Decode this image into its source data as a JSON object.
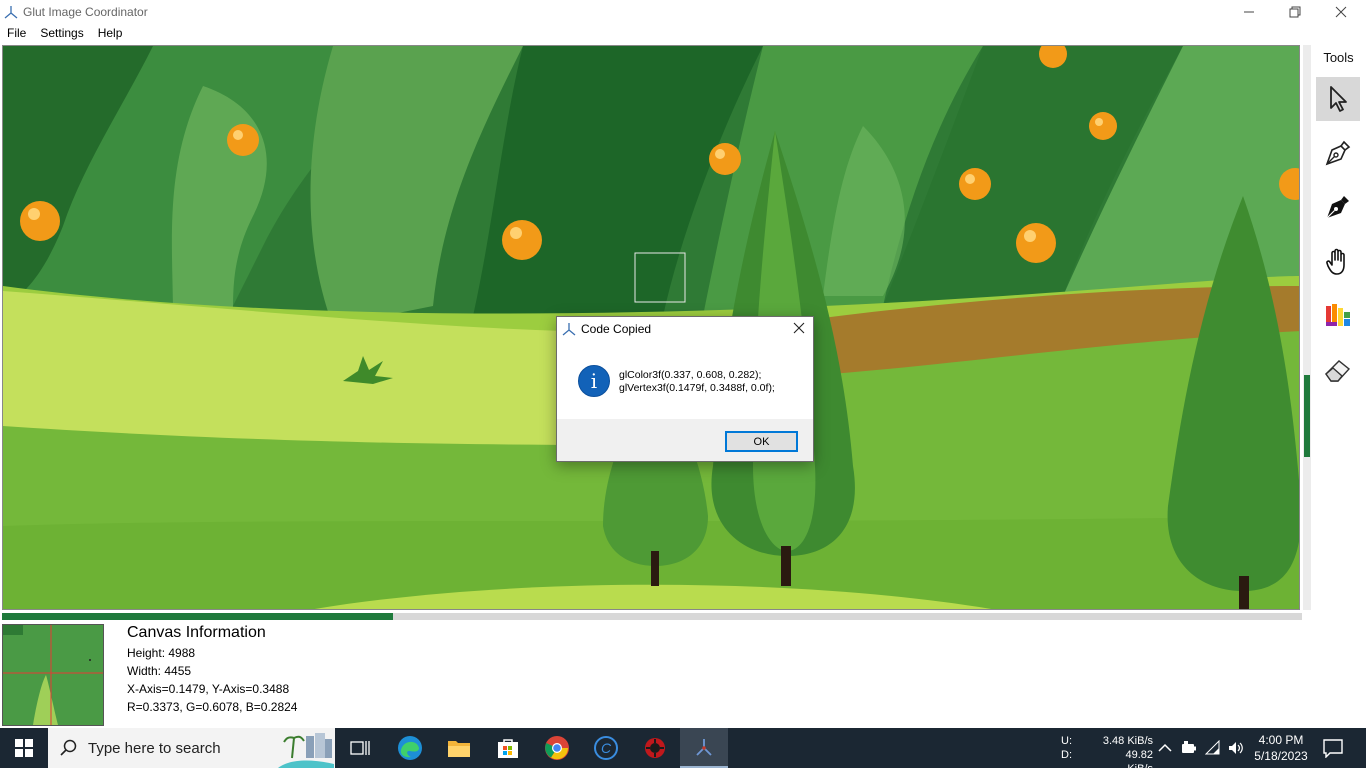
{
  "window": {
    "title": "Glut Image Coordinator"
  },
  "menu": [
    "File",
    "Settings",
    "Help"
  ],
  "tools": {
    "title": "Tools",
    "items": [
      {
        "name": "Select",
        "icon": "cursor-arrow-icon",
        "selected": true
      },
      {
        "name": "Pen outline",
        "icon": "pen-nib-outline-icon",
        "selected": false
      },
      {
        "name": "Pen filled",
        "icon": "pen-nib-filled-icon",
        "selected": false
      },
      {
        "name": "Hand",
        "icon": "hand-icon",
        "selected": false
      },
      {
        "name": "Color palette",
        "icon": "palette-icon",
        "selected": false
      },
      {
        "name": "Eraser",
        "icon": "eraser-icon",
        "selected": false
      }
    ]
  },
  "dialog": {
    "title": "Code Copied",
    "line1": "glColor3f(0.337, 0.608, 0.282);",
    "line2": "glVertex3f(0.1479f, 0.3488f, 0.0f);",
    "ok_label": "OK",
    "icon": "info-icon"
  },
  "canvas_info": {
    "heading": "Canvas Information",
    "height": "Height: 4988",
    "width": "Width: 4455",
    "axis": "X-Axis=0.1479, Y-Axis=0.3488",
    "rgb": "R=0.3373, G=0.6078, B=0.2824"
  },
  "scroll": {
    "horizontal_fraction": 0.3,
    "vertical_fraction": 0.58
  },
  "taskbar": {
    "search_placeholder": "Type here to search",
    "net_up_label": "U:",
    "net_up": "3.48 KiB/s",
    "net_down_label": "D:",
    "net_down": "49.82 KiB/s",
    "time": "4:00 PM",
    "date": "5/18/2023",
    "apps": [
      "task-view-icon",
      "edge-icon",
      "file-explorer-icon",
      "store-icon",
      "chrome-icon",
      "ccleaner-icon",
      "app-red-icon",
      "glut-app-icon"
    ]
  },
  "colors": {
    "accent": "#0078d7",
    "scroll_thumb": "#1f7a3c",
    "taskbar": "#1b2733"
  }
}
